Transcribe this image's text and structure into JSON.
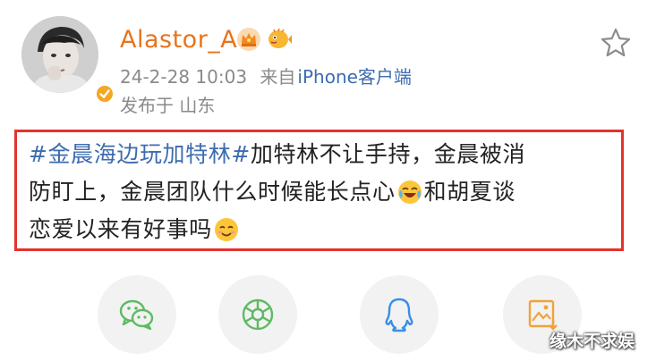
{
  "header": {
    "username": "Alastor_A",
    "badges": [
      "crown-badge-icon",
      "pufferfish-badge-icon"
    ],
    "timestamp": "24-2-28 10:03",
    "source_prefix": "来自",
    "source": "iPhone客户端",
    "location": "发布于 山东"
  },
  "post": {
    "hashtag": "#金晨海边玩加特林#",
    "line1_rest": "加特林不让手持，金晨被消",
    "line2": "防盯上，金晨团队什么时候能长点心",
    "line2_after_emoji": "和胡夏谈",
    "line3": "恋爱以来有好事吗"
  },
  "share": {
    "items": [
      "wechat-icon",
      "moments-icon",
      "qq-icon",
      "save-image-icon"
    ]
  },
  "watermark": "缘木不求娱",
  "colors": {
    "username": "#e8741c",
    "link": "#3d6cb0",
    "highlight_border": "#e5322d",
    "meta": "#8a8a8a"
  }
}
